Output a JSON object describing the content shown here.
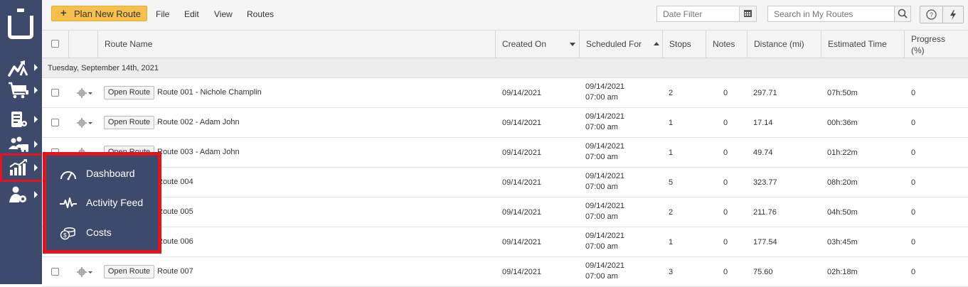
{
  "toolbar": {
    "plan_label": "Plan New Route",
    "menu": [
      "File",
      "Edit",
      "View",
      "Routes"
    ],
    "date_placeholder": "Date Filter",
    "search_placeholder": "Search in My Routes"
  },
  "sidebar": {
    "items": [
      {
        "icon": "routes-icon"
      },
      {
        "icon": "cart-icon"
      },
      {
        "icon": "tracking-icon"
      },
      {
        "icon": "team-icon"
      },
      {
        "icon": "analytics-icon",
        "active": true
      },
      {
        "icon": "user-settings-icon"
      }
    ]
  },
  "flyout": {
    "items": [
      {
        "label": "Dashboard",
        "icon": "speedometer-icon"
      },
      {
        "label": "Activity Feed",
        "icon": "pulse-icon"
      },
      {
        "label": "Costs",
        "icon": "coins-icon"
      }
    ]
  },
  "table": {
    "headers": {
      "route_name": "Route Name",
      "created_on": "Created On",
      "scheduled_for": "Scheduled For",
      "stops": "Stops",
      "notes": "Notes",
      "distance": "Distance (mi)",
      "estimated_time": "Estimated Time",
      "progress": "Progress (%)"
    },
    "group_label": "Tuesday, September 14th, 2021",
    "open_label": "Open Route",
    "rows": [
      {
        "name": "Route 001 - Nichole Champlin",
        "created": "09/14/2021",
        "sched_date": "09/14/2021",
        "sched_time": "07:00 am",
        "stops": "2",
        "notes": "0",
        "distance": "297.71",
        "time": "07h:50m",
        "progress": "0"
      },
      {
        "name": "Route 002 - Adam John",
        "created": "09/14/2021",
        "sched_date": "09/14/2021",
        "sched_time": "07:00 am",
        "stops": "1",
        "notes": "0",
        "distance": "17.14",
        "time": "00h:36m",
        "progress": "0"
      },
      {
        "name": "Route 003 - Adam John",
        "created": "09/14/2021",
        "sched_date": "09/14/2021",
        "sched_time": "07:00 am",
        "stops": "1",
        "notes": "0",
        "distance": "49.74",
        "time": "01h:22m",
        "progress": "0"
      },
      {
        "name": "Route 004",
        "created": "09/14/2021",
        "sched_date": "09/14/2021",
        "sched_time": "07:00 am",
        "stops": "5",
        "notes": "0",
        "distance": "323.77",
        "time": "08h:20m",
        "progress": "0"
      },
      {
        "name": "Route 005",
        "created": "09/14/2021",
        "sched_date": "09/14/2021",
        "sched_time": "07:00 am",
        "stops": "2",
        "notes": "0",
        "distance": "211.76",
        "time": "04h:50m",
        "progress": "0"
      },
      {
        "name": "Route 006",
        "created": "09/14/2021",
        "sched_date": "09/14/2021",
        "sched_time": "07:00 am",
        "stops": "1",
        "notes": "0",
        "distance": "177.54",
        "time": "03h:45m",
        "progress": "0"
      },
      {
        "name": "Route 007",
        "created": "09/14/2021",
        "sched_date": "09/14/2021",
        "sched_time": "07:00 am",
        "stops": "3",
        "notes": "0",
        "distance": "75.60",
        "time": "02h:18m",
        "progress": "0"
      }
    ]
  },
  "colors": {
    "sidebar": "#3d4a6b",
    "accent": "#f7c04a",
    "highlight": "#e3141e"
  }
}
